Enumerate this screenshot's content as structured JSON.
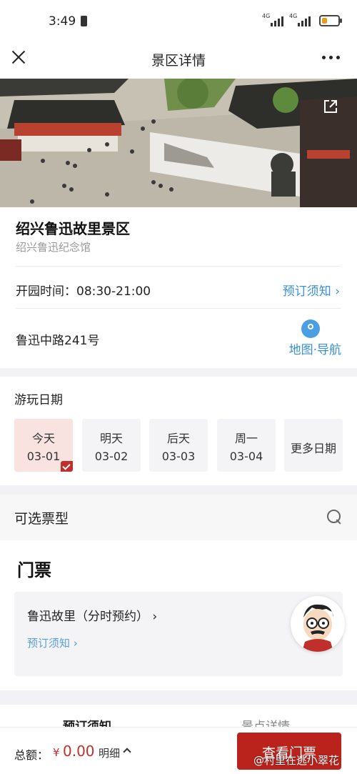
{
  "status_bar": {
    "time": "3:49",
    "network_1": "4G",
    "network_2": "4G"
  },
  "nav": {
    "title": "景区详情"
  },
  "site": {
    "name": "绍兴鲁迅故里景区",
    "subtitle": "绍兴鲁迅纪念馆",
    "hours": "开园时间：08:30-21:00",
    "booking_notice": "预订须知",
    "address": "鲁迅中路241号",
    "map_nav": "地图·导航"
  },
  "dates": {
    "title": "游玩日期",
    "items": [
      {
        "label": "今天",
        "date": "03-01",
        "selected": true
      },
      {
        "label": "明天",
        "date": "03-02"
      },
      {
        "label": "后天",
        "date": "03-03"
      },
      {
        "label": "周一",
        "date": "03-04"
      }
    ],
    "more": "更多日期"
  },
  "ticket_types": {
    "label": "可选票型"
  },
  "tickets": {
    "heading": "门票",
    "item_name": "鲁迅故里（分时预约）",
    "item_notice": "预订须知"
  },
  "tabs": {
    "left": "预订须知",
    "right": "景点详情"
  },
  "bottom": {
    "total_label": "总额：",
    "currency": "¥",
    "total_value": "0.00",
    "detail": "明细",
    "cta": "查看门票"
  },
  "watermark": "@村里在逃小翠花",
  "colors": {
    "accent_red": "#b9231c",
    "link_blue": "#3a8fd9"
  }
}
